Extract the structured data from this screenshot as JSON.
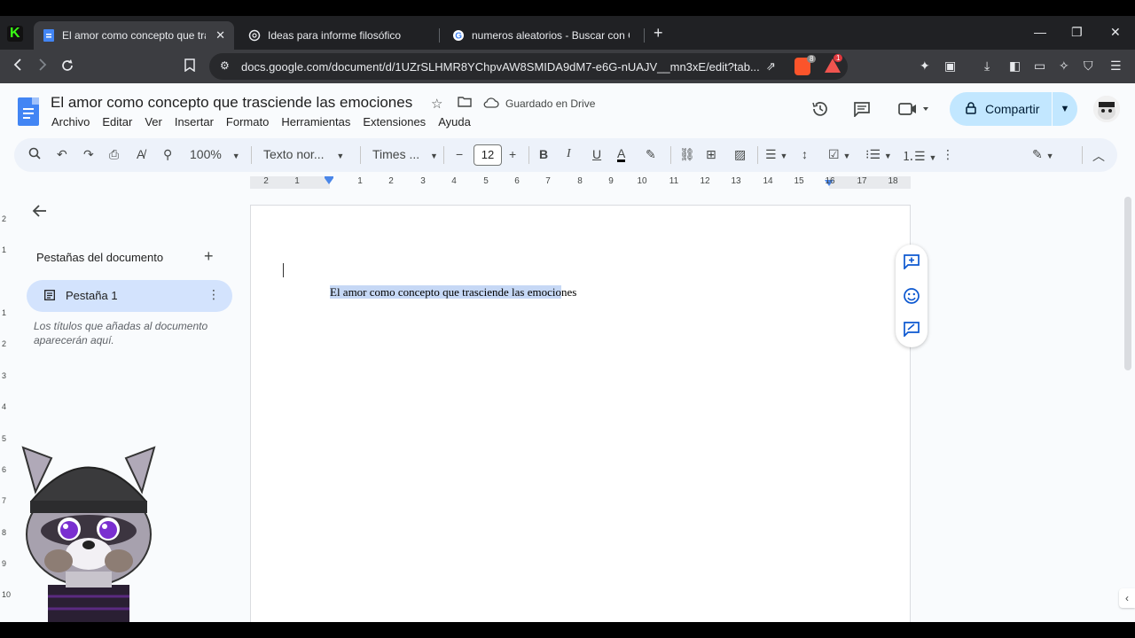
{
  "browser": {
    "tabs": [
      {
        "title": "El amor como concepto que tras",
        "active": true
      },
      {
        "title": "Ideas para informe filosófico",
        "active": false
      },
      {
        "title": "numeros aleatorios - Buscar con Goo",
        "active": false
      }
    ],
    "url": "docs.google.com/document/d/1UZrSLHMR8YChpvAW8SMIDA9dM7-e6G-nUAJV__mn3xE/edit?tab...",
    "badge_count": "1",
    "shield_count": "8"
  },
  "docs": {
    "title": "El amor como concepto que trasciende las emociones",
    "saved_status": "Guardado en Drive",
    "menu": [
      "Archivo",
      "Editar",
      "Ver",
      "Insertar",
      "Formato",
      "Herramientas",
      "Extensiones",
      "Ayuda"
    ],
    "share_label": "Compartir",
    "toolbar": {
      "zoom": "100%",
      "style": "Texto nor...",
      "font": "Times ...",
      "font_size": "12"
    },
    "ruler_h": [
      "2",
      "1",
      "",
      "1",
      "2",
      "3",
      "4",
      "5",
      "6",
      "7",
      "8",
      "9",
      "10",
      "11",
      "12",
      "13",
      "14",
      "15",
      "16",
      "17",
      "18"
    ],
    "ruler_v": [
      "2",
      "1",
      "1",
      "2",
      "3",
      "4",
      "5",
      "6",
      "7",
      "8",
      "9",
      "10"
    ]
  },
  "sidebar": {
    "title": "Pestañas del documento",
    "tab_label": "Pestaña 1",
    "hint": "Los títulos que añadas al documento aparecerán aquí."
  },
  "page": {
    "text_selected": "El amor como concepto que trasciende las emocio",
    "text_rest": "nes"
  },
  "colors": {
    "accent": "#0b57d0",
    "share_bg": "#c2e7ff",
    "toolbar_bg": "#edf2fa",
    "selection": "#c6d8f5"
  }
}
